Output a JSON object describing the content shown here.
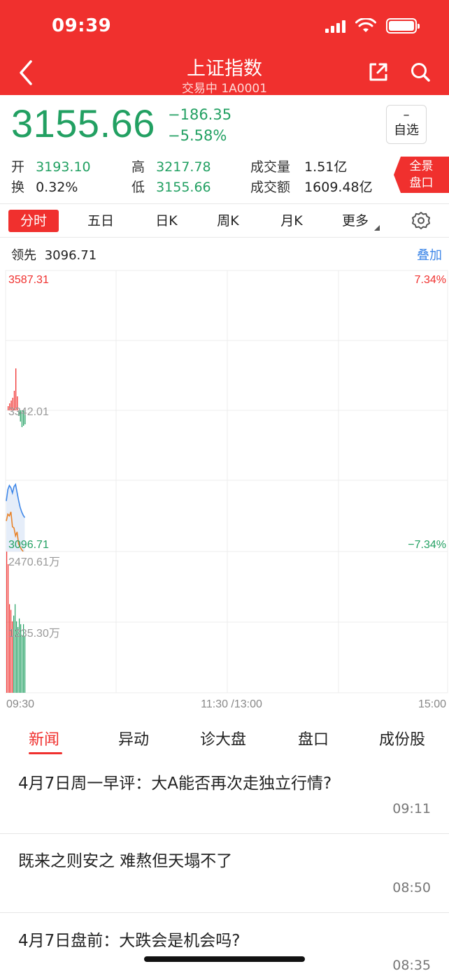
{
  "status_bar": {
    "time": "09:39"
  },
  "header": {
    "title": "上证指数",
    "subtitle": "交易中 1A0001"
  },
  "quote": {
    "price": "3155.66",
    "change": "−186.35",
    "change_pct": "−5.58%",
    "watch": {
      "dash": "–",
      "label": "自选"
    }
  },
  "stats": [
    {
      "label": "开",
      "value": "3193.10",
      "color": "green"
    },
    {
      "label": "换",
      "value": "0.32%",
      "color": "black"
    },
    {
      "label": "高",
      "value": "3217.78",
      "color": "green"
    },
    {
      "label": "低",
      "value": "3155.66",
      "color": "green"
    },
    {
      "label": "成交量",
      "value": "1.51亿",
      "color": "black"
    },
    {
      "label": "成交额",
      "value": "1609.48亿",
      "color": "black"
    }
  ],
  "full_panel_button": {
    "line1": "全景",
    "line2": "盘口"
  },
  "chart_tabs": [
    "分时",
    "五日",
    "日K",
    "周K",
    "月K",
    "更多"
  ],
  "active_chart_tab": 0,
  "lead": {
    "label": "领先",
    "value": "3096.71",
    "overlay": "叠加"
  },
  "colors": {
    "red": "#f0302e",
    "green": "#22a062",
    "blue": "#3d86e8",
    "orange": "#e8832a"
  },
  "chart_data": {
    "type": "line",
    "price_axis": {
      "top": "3587.31",
      "mid": "3342.01",
      "bottom": "3096.71",
      "ylim": [
        3096.71,
        3587.31
      ]
    },
    "pct_axis": {
      "top": "7.34%",
      "bottom": "−7.34%"
    },
    "volume_axis": {
      "top": "2470.61万",
      "mid": "1235.30万"
    },
    "time_axis": [
      "09:30",
      "11:30 /13:00",
      "15:00"
    ],
    "series": [
      {
        "values": [
          3185,
          3205,
          3212,
          3208,
          3199,
          3210,
          3214,
          3200,
          3186,
          3174,
          3166,
          3160,
          3156
        ]
      },
      {
        "values": [
          3150,
          3162,
          3159,
          3166,
          3140,
          3138,
          3124,
          3131,
          3110,
          3105,
          3100,
          3097
        ]
      }
    ],
    "lead_bars": [
      3,
      5,
      7,
      9,
      14,
      30,
      10,
      -4,
      -8,
      -12,
      -11,
      -10
    ],
    "volume": [
      2470,
      2250,
      1550,
      1450,
      1250,
      1350,
      1550,
      1250,
      1150,
      1300,
      1200,
      1000,
      1200,
      1000
    ]
  },
  "news_tabs": [
    "新闻",
    "异动",
    "诊大盘",
    "盘口",
    "成份股"
  ],
  "active_news_tab": 0,
  "news": [
    {
      "title": "4月7日周一早评：大A能否再次走独立行情?",
      "time": "09:11"
    },
    {
      "title": "既来之则安之 难熬但天塌不了",
      "time": "08:50"
    },
    {
      "title": "4月7日盘前：大跌会是机会吗?",
      "time": "08:35"
    }
  ]
}
